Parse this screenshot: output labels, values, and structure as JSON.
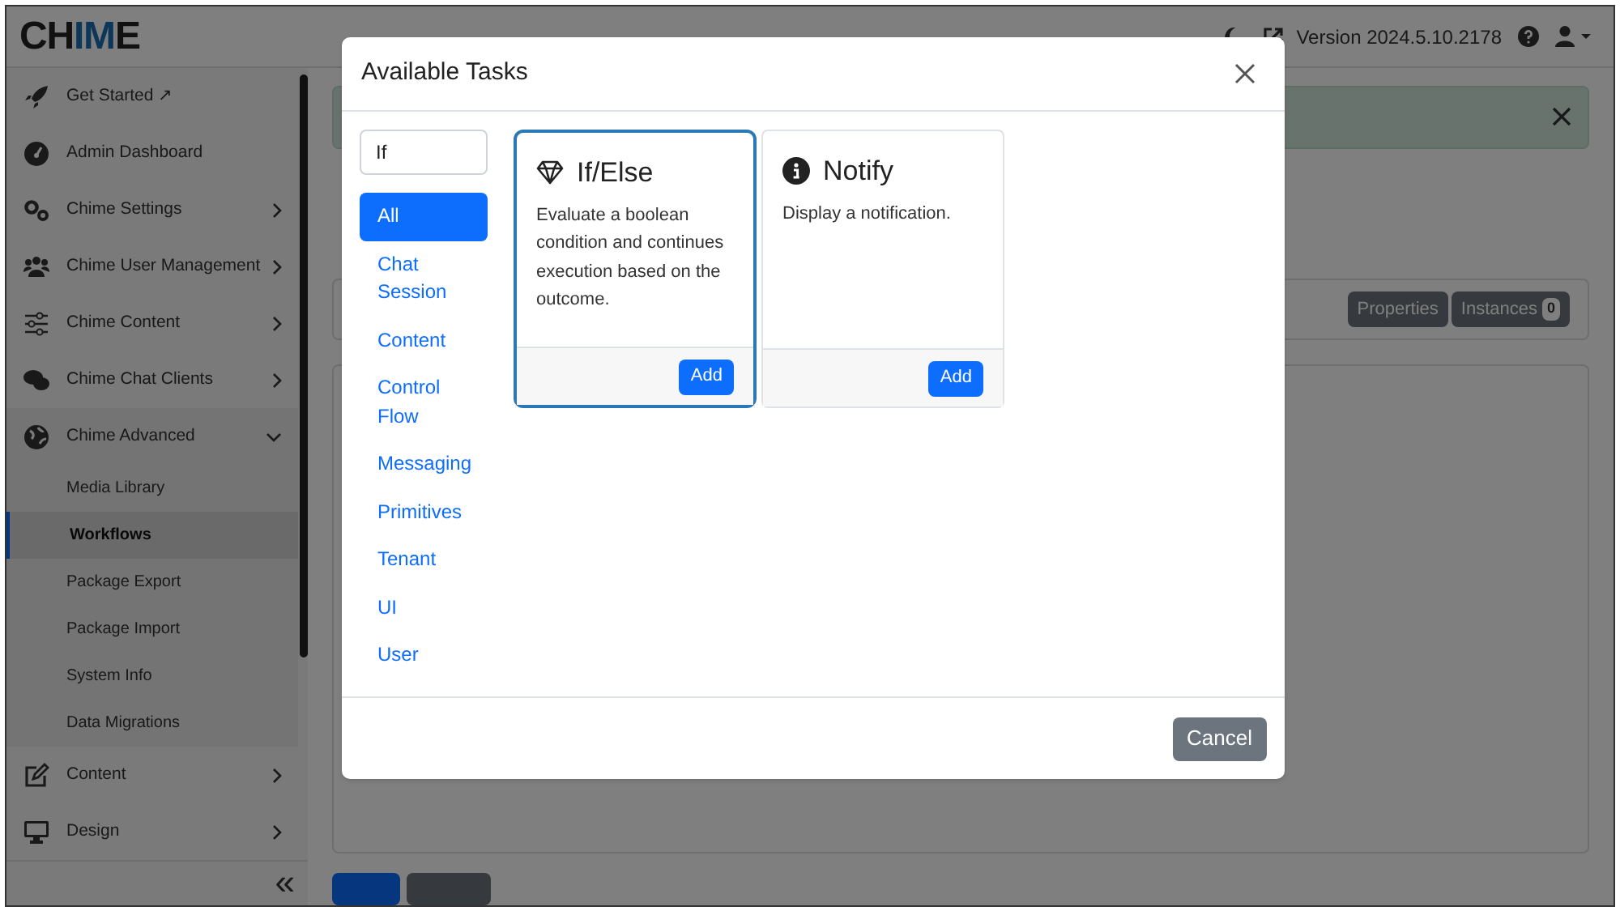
{
  "header": {
    "logo": [
      {
        "text": "CH",
        "accent": false
      },
      {
        "text": "IM",
        "accent": true
      },
      {
        "text": "E",
        "accent": false
      }
    ],
    "version": "Version 2024.5.10.2178"
  },
  "sidebar": {
    "items": [
      {
        "label": "Get Started ↗",
        "kind": "link"
      },
      {
        "label": "Admin Dashboard",
        "kind": "link"
      },
      {
        "label": "Chime Settings",
        "kind": "group",
        "expanded": false
      },
      {
        "label": "Chime User Management",
        "kind": "group",
        "expanded": false
      },
      {
        "label": "Chime Content",
        "kind": "group",
        "expanded": false
      },
      {
        "label": "Chime Chat Clients",
        "kind": "group",
        "expanded": false
      },
      {
        "label": "Chime Advanced",
        "kind": "group",
        "expanded": true,
        "children": [
          {
            "label": "Media Library",
            "selected": false
          },
          {
            "label": "Workflows",
            "selected": true
          },
          {
            "label": "Package Export",
            "selected": false
          },
          {
            "label": "Package Import",
            "selected": false
          },
          {
            "label": "System Info",
            "selected": false
          },
          {
            "label": "Data Migrations",
            "selected": false
          }
        ]
      },
      {
        "label": "Content",
        "kind": "group",
        "expanded": false
      },
      {
        "label": "Design",
        "kind": "group",
        "expanded": false
      }
    ],
    "collapse": "«"
  },
  "main": {
    "buttons": [
      {
        "label": "Properties"
      },
      {
        "label": "Instances",
        "badge": "0"
      }
    ]
  },
  "modal": {
    "title": "Available Tasks",
    "search": {
      "value": "If"
    },
    "categories": [
      {
        "label": "All",
        "selected": true
      },
      {
        "label": "Chat Session",
        "selected": false
      },
      {
        "label": "Content",
        "selected": false
      },
      {
        "label": "Control Flow",
        "selected": false
      },
      {
        "label": "Messaging",
        "selected": false
      },
      {
        "label": "Primitives",
        "selected": false
      },
      {
        "label": "Tenant",
        "selected": false
      },
      {
        "label": "UI",
        "selected": false
      },
      {
        "label": "User",
        "selected": false
      }
    ],
    "tasks": [
      {
        "title": "If/Else",
        "description": "Evaluate a boolean condition and continues execution based on the outcome.",
        "button": "Add",
        "selected": true
      },
      {
        "title": "Notify",
        "description": "Display a notification.",
        "button": "Add",
        "selected": false
      }
    ],
    "cancel": "Cancel"
  }
}
